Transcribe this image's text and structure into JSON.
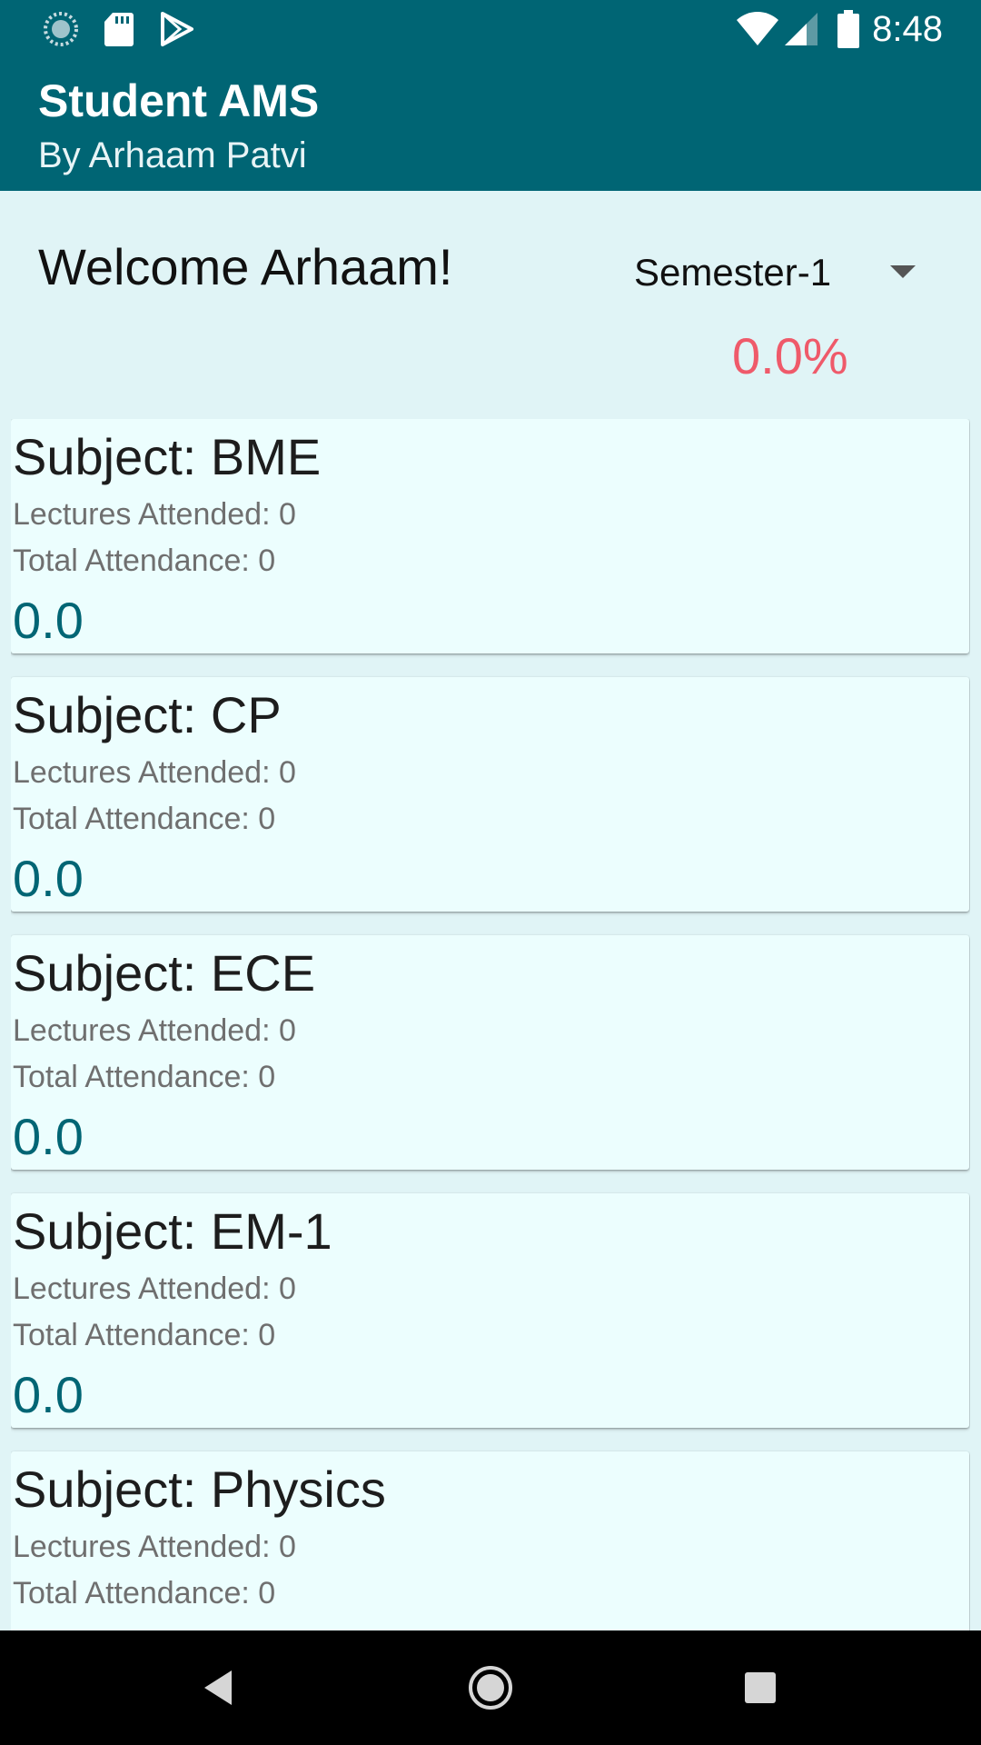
{
  "status_bar": {
    "time": "8:48",
    "left_icons": [
      "sync-icon",
      "sd-card-icon",
      "play-store-icon"
    ],
    "right_icons": [
      "wifi-icon",
      "cell-signal-icon",
      "battery-icon"
    ]
  },
  "app_bar": {
    "title": "Student AMS",
    "subtitle": "By Arhaam Patvi"
  },
  "header": {
    "welcome": "Welcome Arhaam!",
    "semester_selected": "Semester-1",
    "overall_percentage": "0.0%"
  },
  "subjects": [
    {
      "title": "Subject: BME",
      "lectures": "Lectures Attended: 0",
      "total": "Total Attendance: 0",
      "percentage": "0.0"
    },
    {
      "title": "Subject: CP",
      "lectures": "Lectures Attended: 0",
      "total": "Total Attendance: 0",
      "percentage": "0.0"
    },
    {
      "title": "Subject: ECE",
      "lectures": "Lectures Attended: 0",
      "total": "Total Attendance: 0",
      "percentage": "0.0"
    },
    {
      "title": "Subject: EM-1",
      "lectures": "Lectures Attended: 0",
      "total": "Total Attendance: 0",
      "percentage": "0.0"
    },
    {
      "title": "Subject: Physics",
      "lectures": "Lectures Attended: 0",
      "total": "Total Attendance: 0"
    }
  ],
  "nav_bar": {
    "buttons": [
      "back-icon",
      "home-icon",
      "recents-icon"
    ]
  },
  "colors": {
    "primary": "#006574",
    "background": "#e0f4f6",
    "card": "#ecfefe",
    "accent_red": "#ef5a6a"
  }
}
